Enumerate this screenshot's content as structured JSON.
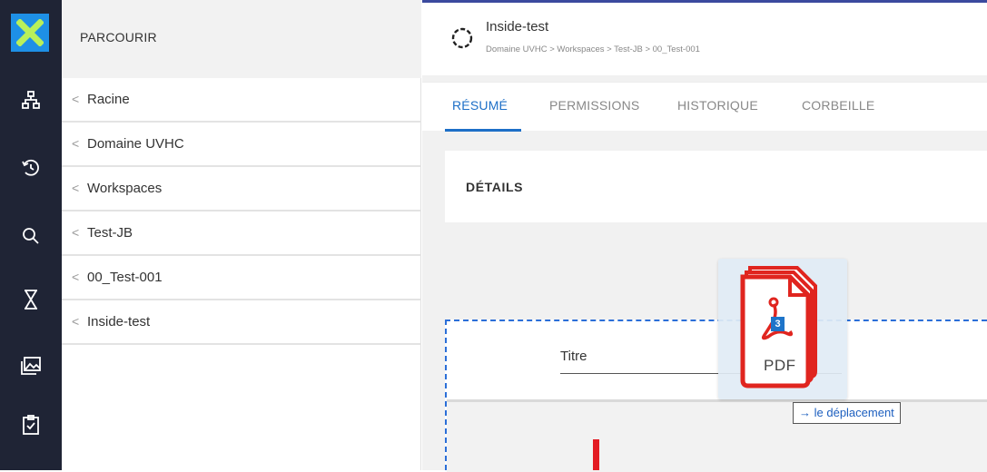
{
  "rail": {
    "icons": [
      "logo-x-icon",
      "sitemap-icon",
      "history-icon",
      "search-icon",
      "hourglass-icon",
      "gallery-icon",
      "checklist-icon"
    ]
  },
  "browse": {
    "title": "PARCOURIR",
    "crumbs": [
      {
        "chevron": "<",
        "label": "Racine"
      },
      {
        "chevron": "<",
        "label": "Domaine UVHC"
      },
      {
        "chevron": "<",
        "label": "Workspaces"
      },
      {
        "chevron": "<",
        "label": "Test-JB"
      },
      {
        "chevron": "<",
        "label": "00_Test-001"
      },
      {
        "chevron": "<",
        "label": "Inside-test"
      }
    ]
  },
  "document": {
    "title": "Inside-test",
    "path": "Domaine UVHC > Workspaces > Test-JB > 00_Test-001"
  },
  "tabs": [
    {
      "label": "RÉSUMÉ",
      "active": true
    },
    {
      "label": "PERMISSIONS",
      "active": false
    },
    {
      "label": "HISTORIQUE",
      "active": false
    },
    {
      "label": "CORBEILLE",
      "active": false
    }
  ],
  "details": {
    "title": "DÉTAILS"
  },
  "dropzone": {
    "field_label": "Titre"
  },
  "drag": {
    "file_type": "PDF",
    "count": "3",
    "tooltip_arrow": "→",
    "tooltip_text": "le déplacement"
  },
  "colors": {
    "rail": "#1f2435",
    "accent": "#1d6fc7",
    "logo": "#1e90e6",
    "pdf_red": "#e0251f",
    "dashed_border": "#2b6fd8"
  }
}
